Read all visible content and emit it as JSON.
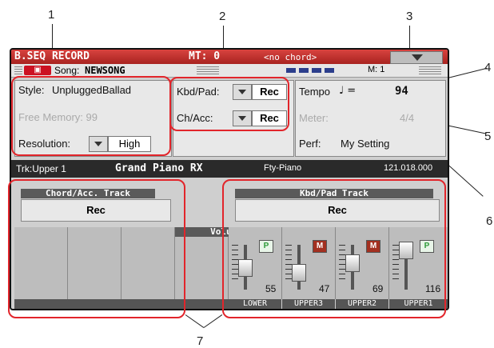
{
  "callouts": [
    "1",
    "2",
    "3",
    "4",
    "5",
    "6",
    "7"
  ],
  "titlebar": {
    "title": "B.SEQ RECORD",
    "mt": "MT: 0",
    "chord": "<no chord>"
  },
  "songbar": {
    "song_label": "Song:",
    "song_name": "NEWSONG",
    "measure": "M: 1"
  },
  "left_panel": {
    "style_label": "Style:",
    "style_value": "UnpluggedBallad",
    "free_memory": "Free Memory: 99",
    "resolution_label": "Resolution:",
    "resolution_value": "High"
  },
  "mid_panel": {
    "kbdpad_label": "Kbd/Pad:",
    "kbdpad_value": "Rec",
    "chacc_label": "Ch/Acc:",
    "chacc_value": "Rec"
  },
  "right_panel": {
    "tempo_label": "Tempo",
    "tempo_note": "♩ =",
    "tempo_value": "94",
    "meter_label": "Meter:",
    "meter_value": "4/4",
    "perf_label": "Perf:",
    "perf_value": "My Setting"
  },
  "trackbar": {
    "track": "Trk:Upper 1",
    "sound": "Grand Piano RX",
    "family": "Fty-Piano",
    "bank": "121.018.000"
  },
  "chord_track": {
    "header": "Chord/Acc. Track",
    "button": "Rec"
  },
  "kbd_track": {
    "header": "Kbd/Pad Track",
    "button": "Rec"
  },
  "mixer": {
    "volume_header": "Volume",
    "channels": [
      {
        "label": "LOWER",
        "volume": "55",
        "badge": "P"
      },
      {
        "label": "UPPER3",
        "volume": "47",
        "badge": "M"
      },
      {
        "label": "UPPER2",
        "volume": "69",
        "badge": "M"
      },
      {
        "label": "UPPER1",
        "volume": "116",
        "badge": "P"
      }
    ]
  },
  "colors": {
    "title_red": "#c62a26",
    "highlight": "#e2252b",
    "badge_p": "#2e9a3a",
    "badge_m": "#a33020"
  }
}
